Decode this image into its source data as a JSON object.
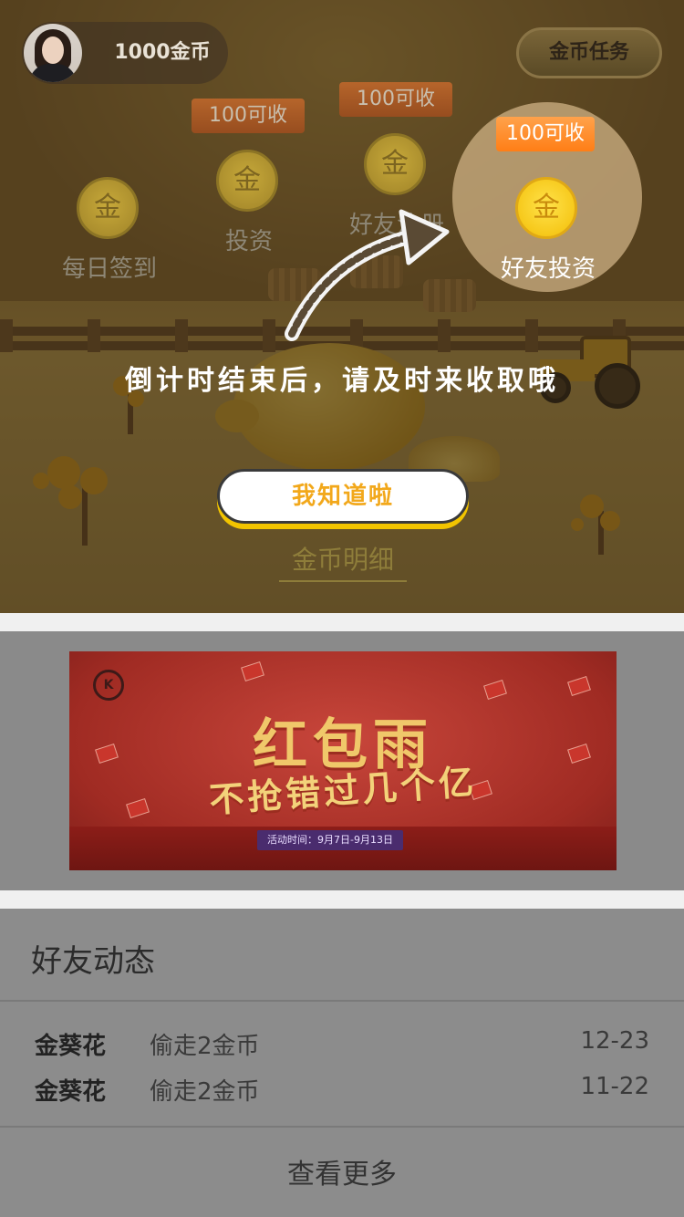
{
  "header": {
    "coin_balance": "1000金币",
    "task_button": "金币任务"
  },
  "tasks": [
    {
      "label": "每日签到",
      "coin_glyph": "金",
      "ready": ""
    },
    {
      "label": "投资",
      "coin_glyph": "金",
      "ready": "100可收"
    },
    {
      "label": "好友注册",
      "coin_glyph": "金",
      "ready": "100可收"
    },
    {
      "label": "好友投资",
      "coin_glyph": "金",
      "ready": "100可收"
    }
  ],
  "guide": {
    "tip": "倒计时结束后，请及时来收取哦",
    "confirm_button": "我知道啦",
    "detail_link": "金币明细"
  },
  "banner": {
    "logo": "K",
    "title_line1": "红包雨",
    "title_line2": "不抢错过几个亿",
    "date_text": "活动时间：9月7日-9月13日"
  },
  "feed": {
    "title": "好友动态",
    "items": [
      {
        "name": "金葵花",
        "action": "偷走2金币",
        "date": "12-23"
      },
      {
        "name": "金葵花",
        "action": "偷走2金币",
        "date": "11-22"
      }
    ],
    "more": "查看更多"
  },
  "colors": {
    "accent_orange": "#ff7e16",
    "coin_gold": "#f5c514",
    "button_text": "#f2a81b"
  }
}
